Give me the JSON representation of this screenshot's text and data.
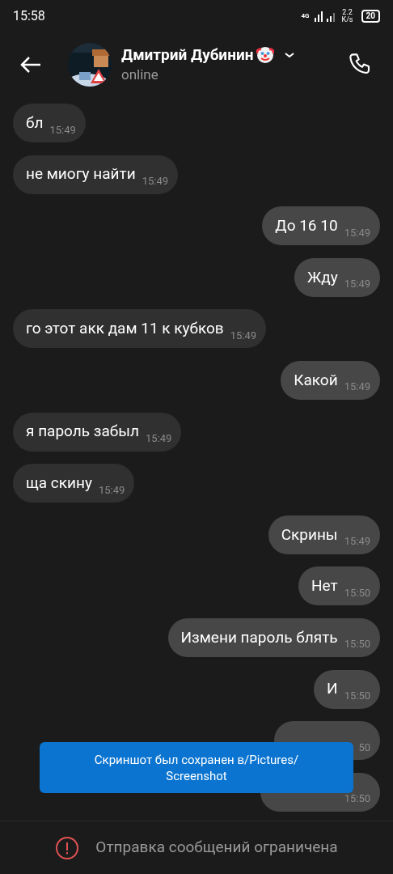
{
  "status_bar": {
    "time": "15:58",
    "network": "4G",
    "speed_value": "2.2",
    "speed_unit": "K/s",
    "battery": "20"
  },
  "header": {
    "name": "Дмитрий Дубинин",
    "status": "online"
  },
  "messages": [
    {
      "text": "бл",
      "time": "15:49",
      "outgoing": false
    },
    {
      "text": "не миогу найти",
      "time": "15:49",
      "outgoing": false
    },
    {
      "text": "До 16 10",
      "time": "15:49",
      "outgoing": true
    },
    {
      "text": "Жду",
      "time": "15:49",
      "outgoing": true
    },
    {
      "text": "го этот акк дам 11 к кубков",
      "time": "15:49",
      "outgoing": false
    },
    {
      "text": "Какой",
      "time": "15:49",
      "outgoing": true
    },
    {
      "text": "я пароль забыл",
      "time": "15:49",
      "outgoing": false
    },
    {
      "text": "ща скину",
      "time": "15:49",
      "outgoing": false
    },
    {
      "text": "Скрины",
      "time": "15:49",
      "outgoing": true
    },
    {
      "text": "Нет",
      "time": "15:50",
      "outgoing": true
    },
    {
      "text": "Измени пароль блять",
      "time": "15:50",
      "outgoing": true
    },
    {
      "text": "И",
      "time": "15:50",
      "outgoing": true
    },
    {
      "time": "50",
      "outgoing": true
    },
    {
      "time": "15:50",
      "outgoing": true
    }
  ],
  "toast": {
    "text": "Скриншот был сохранен в/Pictures/ Screenshot"
  },
  "footer": {
    "notice": "Отправка сообщений ограничена"
  }
}
